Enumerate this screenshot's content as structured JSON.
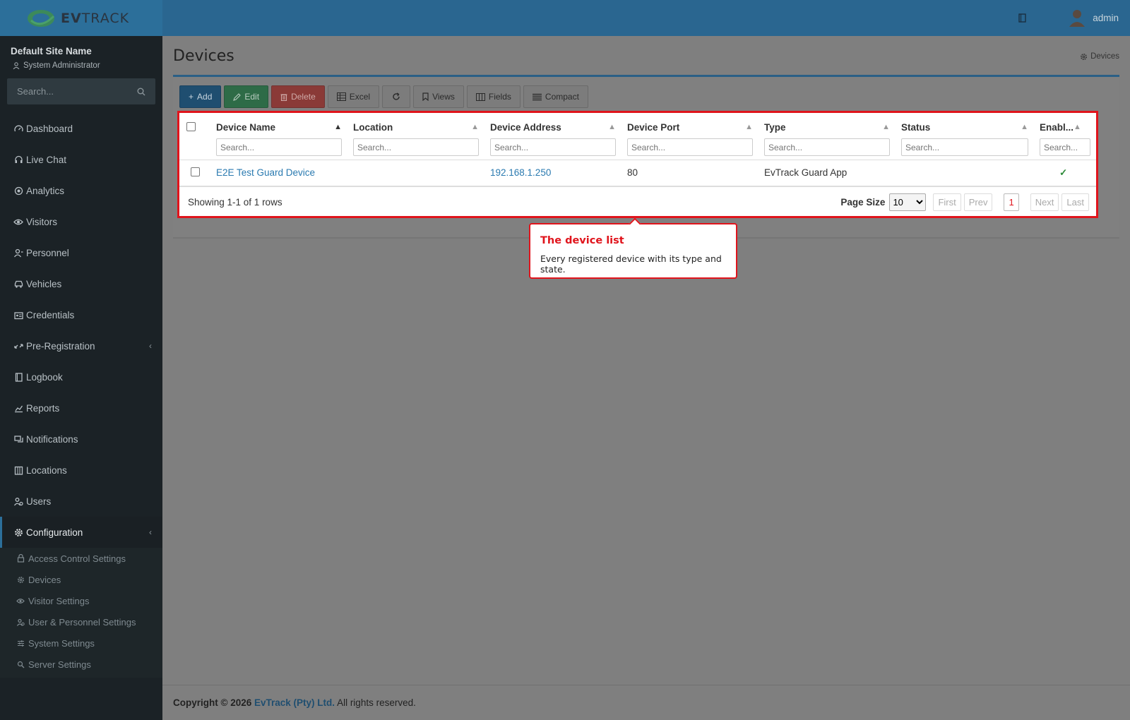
{
  "brand": {
    "name_bold": "EV",
    "name_rest": "TRACK"
  },
  "user_panel": {
    "site_name": "Default Site Name",
    "role": "System Administrator",
    "search_placeholder": "Search..."
  },
  "topbar": {
    "username": "admin"
  },
  "nav": {
    "items": [
      {
        "label": "Dashboard",
        "icon": "dashboard-icon"
      },
      {
        "label": "Live Chat",
        "icon": "headset-icon"
      },
      {
        "label": "Analytics",
        "icon": "analytics-icon"
      },
      {
        "label": "Visitors",
        "icon": "eye-icon"
      },
      {
        "label": "Personnel",
        "icon": "personnel-icon"
      },
      {
        "label": "Vehicles",
        "icon": "car-icon"
      },
      {
        "label": "Credentials",
        "icon": "id-card-icon"
      },
      {
        "label": "Pre-Registration",
        "icon": "arrows-icon"
      },
      {
        "label": "Logbook",
        "icon": "book-icon"
      },
      {
        "label": "Reports",
        "icon": "reports-icon"
      },
      {
        "label": "Notifications",
        "icon": "chat-icon"
      },
      {
        "label": "Locations",
        "icon": "building-icon"
      },
      {
        "label": "Users",
        "icon": "users-icon"
      },
      {
        "label": "Configuration",
        "icon": "gear-icon"
      }
    ],
    "sub_items": [
      {
        "label": "Access Control Settings",
        "icon": "lock-icon"
      },
      {
        "label": "Devices",
        "icon": "cog-icon"
      },
      {
        "label": "Visitor Settings",
        "icon": "eye-icon"
      },
      {
        "label": "User & Personnel Settings",
        "icon": "users-icon"
      },
      {
        "label": "System Settings",
        "icon": "sliders-icon"
      },
      {
        "label": "Server Settings",
        "icon": "server-icon"
      }
    ]
  },
  "page": {
    "title": "Devices",
    "breadcrumb": "Devices"
  },
  "toolbar": {
    "add": "Add",
    "edit": "Edit",
    "delete": "Delete",
    "excel": "Excel",
    "views": "Views",
    "fields": "Fields",
    "compact": "Compact"
  },
  "table": {
    "columns": [
      {
        "label": "Device Name",
        "placeholder": "Search..."
      },
      {
        "label": "Location",
        "placeholder": "Search..."
      },
      {
        "label": "Device Address",
        "placeholder": "Search..."
      },
      {
        "label": "Device Port",
        "placeholder": "Search..."
      },
      {
        "label": "Type",
        "placeholder": "Search..."
      },
      {
        "label": "Status",
        "placeholder": "Search..."
      },
      {
        "label": "Enabl...",
        "placeholder": "Search..."
      }
    ],
    "rows": [
      {
        "device_name": "E2E Test Guard Device",
        "location": "",
        "device_address": "192.168.1.250",
        "device_port": "80",
        "type": "EvTrack Guard App",
        "status": "",
        "enabled": "✓"
      }
    ],
    "showing": "Showing 1-1 of 1 rows",
    "page_size_label": "Page Size",
    "page_size_value": "10",
    "pager": {
      "first": "First",
      "prev": "Prev",
      "current": "1",
      "next": "Next",
      "last": "Last"
    }
  },
  "tooltip": {
    "title": "The device list",
    "body": "Every registered device with its type and state."
  },
  "footer": {
    "prefix": "Copyright © 2026",
    "company": "EvTrack (Pty) Ltd.",
    "suffix": "All rights reserved."
  },
  "colors": {
    "accent": "#2a6690",
    "highlight": "#e0141c",
    "link": "#2a7ab0",
    "sidebar": "#1b2226"
  }
}
